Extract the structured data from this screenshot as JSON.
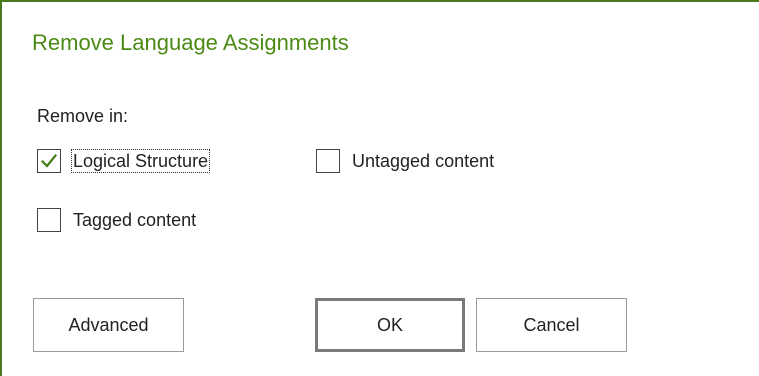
{
  "dialog": {
    "title": "Remove Language Assignments",
    "section_label": "Remove in:",
    "options": [
      {
        "label": "Logical Structure",
        "checked": true,
        "focused": true
      },
      {
        "label": "Untagged content",
        "checked": false,
        "focused": false
      },
      {
        "label": "Tagged content",
        "checked": false,
        "focused": false
      }
    ],
    "buttons": {
      "advanced": "Advanced",
      "ok": "OK",
      "cancel": "Cancel"
    }
  },
  "colors": {
    "title": "#4c8a16",
    "accent_border": "#4a7a1e",
    "checkmark": "#3f7d12"
  },
  "icons": {
    "checkbox_checked": "checkmark-icon"
  }
}
